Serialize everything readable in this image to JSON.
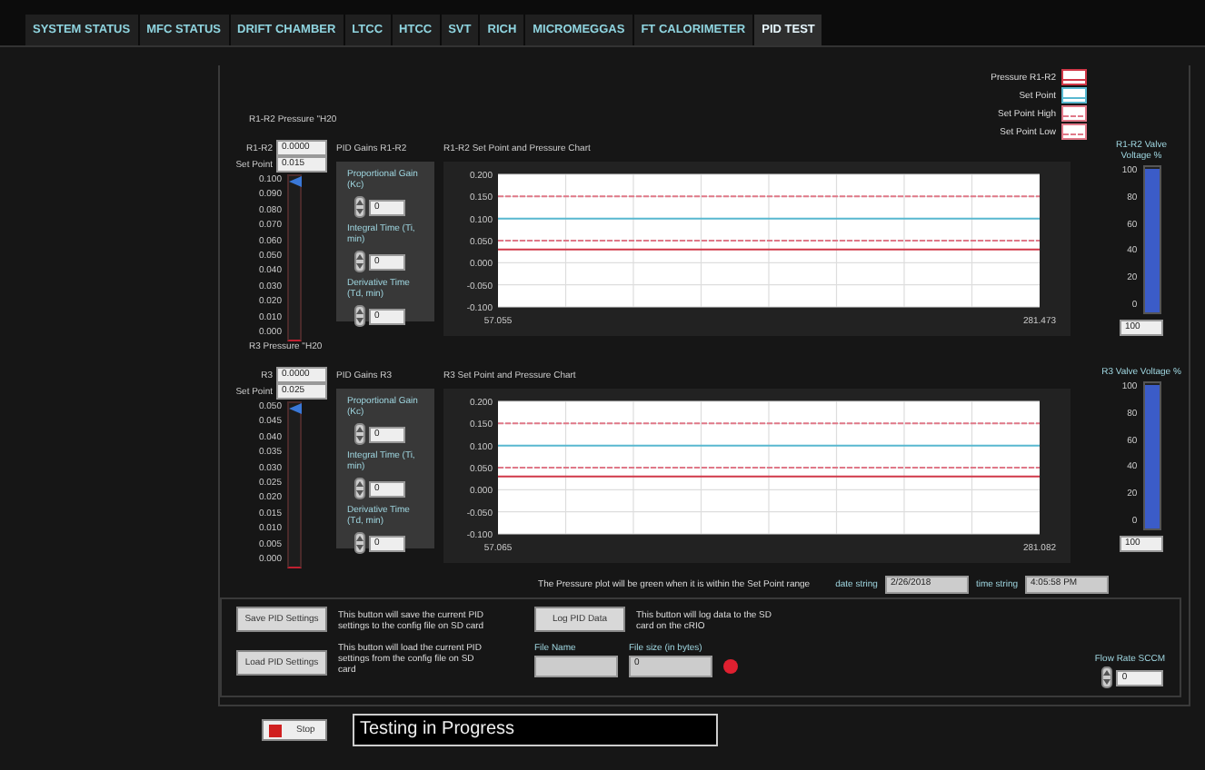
{
  "tabs": [
    {
      "label": "SYSTEM STATUS",
      "selected": false
    },
    {
      "label": "MFC STATUS",
      "selected": false
    },
    {
      "label": "DRIFT CHAMBER",
      "selected": false
    },
    {
      "label": "LTCC",
      "selected": false
    },
    {
      "label": "HTCC",
      "selected": false
    },
    {
      "label": "SVT",
      "selected": false
    },
    {
      "label": "RICH",
      "selected": false
    },
    {
      "label": "MICROMEGGAS",
      "selected": false
    },
    {
      "label": "FT CALORIMETER",
      "selected": false
    },
    {
      "label": "PID TEST",
      "selected": true
    }
  ],
  "sections": [
    {
      "title": "R1-R2 Pressure \"H20",
      "pressure": {
        "label": "R1-R2",
        "value": "0.0000"
      },
      "set_point": {
        "label": "Set Point",
        "value": "0.015"
      },
      "slider": {
        "level": 1,
        "ticks": [
          "0.100",
          "0.090",
          "0.080",
          "0.070",
          "0.060",
          "0.050",
          "0.040",
          "0.030",
          "0.020",
          "0.010",
          "0.000"
        ]
      },
      "gains": {
        "title": "PID Gains R1-R2",
        "items": [
          {
            "label": "Proportional Gain (Kc)",
            "value": "0"
          },
          {
            "label": "Integral Time (Ti, min)",
            "value": "0"
          },
          {
            "label": "Derivative Time (Td, min)",
            "value": "0"
          }
        ]
      },
      "chart_title": "R1-R2 Set Point and Pressure Chart",
      "chart_data": {
        "type": "line",
        "grid": true,
        "x": [
          57.055,
          281.473
        ],
        "xlim": [
          57.055,
          281.473
        ],
        "xticks": [
          {
            "value": 57.055,
            "label": "57.055"
          },
          {
            "value": 281.473,
            "label": "281.473"
          }
        ],
        "ylim": [
          -0.1,
          0.2
        ],
        "yticks": [
          {
            "value": 0.2,
            "label": "0.200"
          },
          {
            "value": 0.15,
            "label": "0.150"
          },
          {
            "value": 0.1,
            "label": "0.100"
          },
          {
            "value": 0.05,
            "label": "0.050"
          },
          {
            "value": 0,
            "label": "0.000"
          },
          {
            "value": -0.05,
            "label": "-0.050"
          },
          {
            "value": -0.1,
            "label": "-0.100"
          }
        ],
        "series": [
          {
            "name": "Pressure R1-R2",
            "color": "#d03848",
            "line_style": "solid",
            "values": [
              0.03,
              0.03
            ]
          },
          {
            "name": "Set Point",
            "color": "#58b8d0",
            "line_style": "solid",
            "values": [
              0.1,
              0.1
            ]
          },
          {
            "name": "Set Point High",
            "color": "#e07888",
            "line_style": "dashed",
            "values": [
              0.15,
              0.15
            ]
          },
          {
            "name": "Set Point Low",
            "color": "#e07888",
            "line_style": "dashed",
            "values": [
              0.05,
              0.05
            ]
          }
        ]
      },
      "valve": {
        "label": "R1-R2 Valve Voltage %",
        "ticks": [
          "100",
          "80",
          "60",
          "40",
          "20",
          "0"
        ],
        "level": 0.99,
        "value": "100"
      }
    },
    {
      "title": "R3 Pressure \"H20",
      "pressure": {
        "label": "R3",
        "value": "0.0000"
      },
      "set_point": {
        "label": "Set Point",
        "value": "0.025"
      },
      "slider": {
        "level": 1,
        "ticks": [
          "0.050",
          "0.045",
          "0.040",
          "0.035",
          "0.030",
          "0.025",
          "0.020",
          "0.015",
          "0.010",
          "0.005",
          "0.000"
        ]
      },
      "gains": {
        "title": "PID Gains R3",
        "items": [
          {
            "label": "Proportional Gain (Kc)",
            "value": "0"
          },
          {
            "label": "Integral Time (Ti, min)",
            "value": "0"
          },
          {
            "label": "Derivative Time (Td, min)",
            "value": "0"
          }
        ]
      },
      "chart_title": "R3 Set Point and Pressure Chart",
      "chart_data": {
        "type": "line",
        "grid": true,
        "x": [
          57.065,
          281.082
        ],
        "xlim": [
          57.065,
          281.082
        ],
        "xticks": [
          {
            "value": 57.065,
            "label": "57.065"
          },
          {
            "value": 281.082,
            "label": "281.082"
          }
        ],
        "ylim": [
          -0.1,
          0.2
        ],
        "yticks": [
          {
            "value": 0.2,
            "label": "0.200"
          },
          {
            "value": 0.15,
            "label": "0.150"
          },
          {
            "value": 0.1,
            "label": "0.100"
          },
          {
            "value": 0.05,
            "label": "0.050"
          },
          {
            "value": 0,
            "label": "0.000"
          },
          {
            "value": -0.05,
            "label": "-0.050"
          },
          {
            "value": -0.1,
            "label": "-0.100"
          }
        ],
        "series": [
          {
            "color": "#d03848",
            "line_style": "solid",
            "values": [
              0.03,
              0.03
            ]
          },
          {
            "color": "#58b8d0",
            "line_style": "solid",
            "values": [
              0.1,
              0.1
            ]
          },
          {
            "color": "#e07888",
            "line_style": "dashed",
            "values": [
              0.15,
              0.15
            ]
          },
          {
            "color": "#e07888",
            "line_style": "dashed",
            "values": [
              0.05,
              0.05
            ]
          }
        ]
      },
      "valve": {
        "label": "R3 Valve Voltage %",
        "ticks": [
          "100",
          "80",
          "60",
          "40",
          "20",
          "0"
        ],
        "level": 0.99,
        "value": "100"
      }
    }
  ],
  "note": "The Pressure plot will be green when it is within the Set Point range",
  "date": {
    "label": "date string",
    "value": "2/26/2018"
  },
  "time": {
    "label": "time string",
    "value": "4:05:58 PM"
  },
  "save": {
    "label": "Save PID Settings",
    "description": "This button will save the current PID settings to the config file on SD card"
  },
  "load": {
    "label": "Load PID Settings",
    "description": "This button will load the current PID settings from the config file on SD card"
  },
  "log": {
    "label": "Log PID Data",
    "description": "This button will log data to the SD card on the cRIO"
  },
  "file_name": {
    "label": "File Name"
  },
  "file_size": {
    "label": "File size (in bytes)",
    "value": "0"
  },
  "log_led": {
    "on": true
  },
  "flow_rate": {
    "label": "Flow Rate SCCM",
    "value": "0"
  },
  "stop": {
    "label": "Stop"
  },
  "status": "Testing in Progress"
}
